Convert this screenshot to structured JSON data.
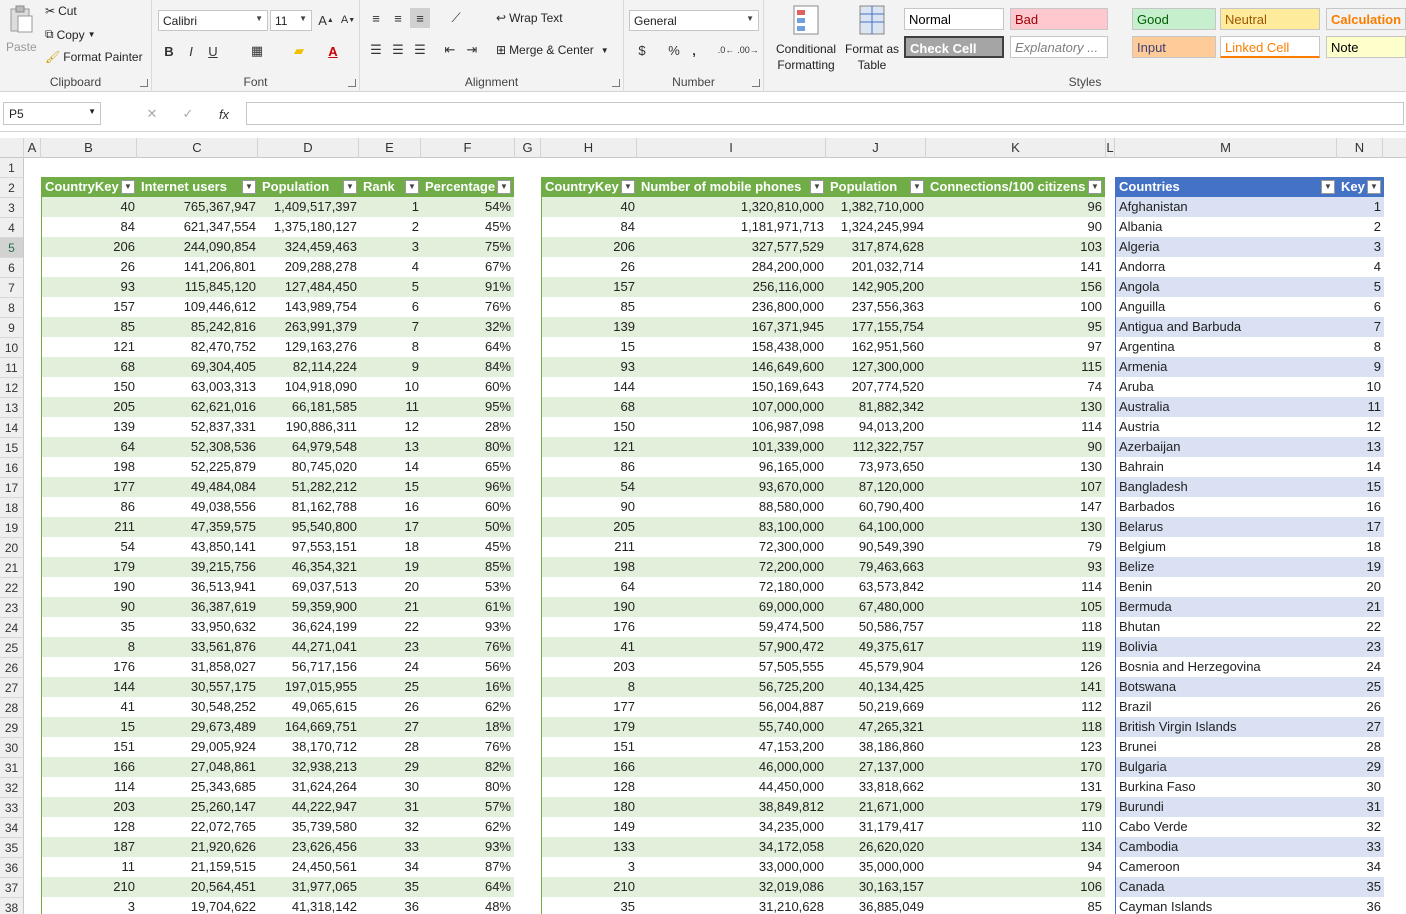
{
  "ribbon": {
    "clipboard": {
      "label": "Clipboard",
      "paste": "Paste",
      "cut": "Cut",
      "copy": "Copy",
      "format_painter": "Format Painter"
    },
    "font": {
      "label": "Font",
      "name": "Calibri",
      "size": "11",
      "bold": "B",
      "italic": "I",
      "underline": "U"
    },
    "alignment": {
      "label": "Alignment",
      "wrap_text": "Wrap Text",
      "merge_center": "Merge & Center"
    },
    "number": {
      "label": "Number",
      "format": "General",
      "currency": "$",
      "percent": "%",
      "comma": ","
    },
    "styles": {
      "label": "Styles",
      "conditional": "Conditional Formatting",
      "format_table": "Format as Table",
      "cells": [
        {
          "name": "Normal",
          "bg": "#ffffff",
          "fg": "#000000"
        },
        {
          "name": "Bad",
          "bg": "#ffc7ce",
          "fg": "#9c0006"
        },
        {
          "name": "Good",
          "bg": "#c6efce",
          "fg": "#006100"
        },
        {
          "name": "Neutral",
          "bg": "#ffeb9c",
          "fg": "#9c5700"
        },
        {
          "name": "Calculation",
          "bg": "#f2f2f2",
          "fg": "#fa7d00"
        },
        {
          "name": "Check Cell",
          "bg": "#a5a5a5",
          "fg": "#ffffff"
        },
        {
          "name": "Explanatory ...",
          "bg": "#ffffff",
          "fg": "#7f7f7f"
        },
        {
          "name": "Input",
          "bg": "#ffcc99",
          "fg": "#3f3f76"
        },
        {
          "name": "Linked Cell",
          "bg": "#ffffff",
          "fg": "#fa7d00"
        },
        {
          "name": "Note",
          "bg": "#ffffcc",
          "fg": "#000000"
        }
      ]
    }
  },
  "formula_bar": {
    "name_box": "P5",
    "fx": "fx"
  },
  "columns": [
    "A",
    "B",
    "C",
    "D",
    "E",
    "F",
    "G",
    "H",
    "I",
    "J",
    "K",
    "L",
    "M",
    "N"
  ],
  "colors": {
    "green_header": "#70ad47",
    "green_band": "#e2efda",
    "blue_header": "#4472c4",
    "blue_band": "#d9e1f2"
  },
  "table1": {
    "headers": [
      "CountryKey",
      "Internet users",
      "Population",
      "Rank",
      "Percentage"
    ],
    "rows": [
      [
        "40",
        "765,367,947",
        "1,409,517,397",
        "1",
        "54%"
      ],
      [
        "84",
        "621,347,554",
        "1,375,180,127",
        "2",
        "45%"
      ],
      [
        "206",
        "244,090,854",
        "324,459,463",
        "3",
        "75%"
      ],
      [
        "26",
        "141,206,801",
        "209,288,278",
        "4",
        "67%"
      ],
      [
        "93",
        "115,845,120",
        "127,484,450",
        "5",
        "91%"
      ],
      [
        "157",
        "109,446,612",
        "143,989,754",
        "6",
        "76%"
      ],
      [
        "85",
        "85,242,816",
        "263,991,379",
        "7",
        "32%"
      ],
      [
        "121",
        "82,470,752",
        "129,163,276",
        "8",
        "64%"
      ],
      [
        "68",
        "69,304,405",
        "82,114,224",
        "9",
        "84%"
      ],
      [
        "150",
        "63,003,313",
        "104,918,090",
        "10",
        "60%"
      ],
      [
        "205",
        "62,621,016",
        "66,181,585",
        "11",
        "95%"
      ],
      [
        "139",
        "52,837,331",
        "190,886,311",
        "12",
        "28%"
      ],
      [
        "64",
        "52,308,536",
        "64,979,548",
        "13",
        "80%"
      ],
      [
        "198",
        "52,225,879",
        "80,745,020",
        "14",
        "65%"
      ],
      [
        "177",
        "49,484,084",
        "51,282,212",
        "15",
        "96%"
      ],
      [
        "86",
        "49,038,556",
        "81,162,788",
        "16",
        "60%"
      ],
      [
        "211",
        "47,359,575",
        "95,540,800",
        "17",
        "50%"
      ],
      [
        "54",
        "43,850,141",
        "97,553,151",
        "18",
        "45%"
      ],
      [
        "179",
        "39,215,756",
        "46,354,321",
        "19",
        "85%"
      ],
      [
        "190",
        "36,513,941",
        "69,037,513",
        "20",
        "53%"
      ],
      [
        "90",
        "36,387,619",
        "59,359,900",
        "21",
        "61%"
      ],
      [
        "35",
        "33,950,632",
        "36,624,199",
        "22",
        "93%"
      ],
      [
        "8",
        "33,561,876",
        "44,271,041",
        "23",
        "76%"
      ],
      [
        "176",
        "31,858,027",
        "56,717,156",
        "24",
        "56%"
      ],
      [
        "144",
        "30,557,175",
        "197,015,955",
        "25",
        "16%"
      ],
      [
        "41",
        "30,548,252",
        "49,065,615",
        "26",
        "62%"
      ],
      [
        "15",
        "29,673,489",
        "164,669,751",
        "27",
        "18%"
      ],
      [
        "151",
        "29,005,924",
        "38,170,712",
        "28",
        "76%"
      ],
      [
        "166",
        "27,048,861",
        "32,938,213",
        "29",
        "82%"
      ],
      [
        "114",
        "25,343,685",
        "31,624,264",
        "30",
        "80%"
      ],
      [
        "203",
        "25,260,147",
        "44,222,947",
        "31",
        "57%"
      ],
      [
        "128",
        "22,072,765",
        "35,739,580",
        "32",
        "62%"
      ],
      [
        "187",
        "21,920,626",
        "23,626,456",
        "33",
        "93%"
      ],
      [
        "11",
        "21,159,515",
        "24,450,561",
        "34",
        "87%"
      ],
      [
        "210",
        "20,564,451",
        "31,977,065",
        "35",
        "64%"
      ],
      [
        "3",
        "19,704,622",
        "41,318,142",
        "36",
        "48%"
      ]
    ]
  },
  "table2": {
    "headers": [
      "CountryKey",
      "Number of mobile phones",
      "Population",
      "Connections/100 citizens"
    ],
    "rows": [
      [
        "40",
        "1,320,810,000",
        "1,382,710,000",
        "96"
      ],
      [
        "84",
        "1,181,971,713",
        "1,324,245,994",
        "90"
      ],
      [
        "206",
        "327,577,529",
        "317,874,628",
        "103"
      ],
      [
        "26",
        "284,200,000",
        "201,032,714",
        "141"
      ],
      [
        "157",
        "256,116,000",
        "142,905,200",
        "156"
      ],
      [
        "85",
        "236,800,000",
        "237,556,363",
        "100"
      ],
      [
        "139",
        "167,371,945",
        "177,155,754",
        "95"
      ],
      [
        "15",
        "158,438,000",
        "162,951,560",
        "97"
      ],
      [
        "93",
        "146,649,600",
        "127,300,000",
        "115"
      ],
      [
        "144",
        "150,169,643",
        "207,774,520",
        "74"
      ],
      [
        "68",
        "107,000,000",
        "81,882,342",
        "130"
      ],
      [
        "150",
        "106,987,098",
        "94,013,200",
        "114"
      ],
      [
        "121",
        "101,339,000",
        "112,322,757",
        "90"
      ],
      [
        "86",
        "96,165,000",
        "73,973,650",
        "130"
      ],
      [
        "54",
        "93,670,000",
        "87,120,000",
        "107"
      ],
      [
        "90",
        "88,580,000",
        "60,790,400",
        "147"
      ],
      [
        "205",
        "83,100,000",
        "64,100,000",
        "130"
      ],
      [
        "211",
        "72,300,000",
        "90,549,390",
        "79"
      ],
      [
        "198",
        "72,200,000",
        "79,463,663",
        "93"
      ],
      [
        "64",
        "72,180,000",
        "63,573,842",
        "114"
      ],
      [
        "190",
        "69,000,000",
        "67,480,000",
        "105"
      ],
      [
        "176",
        "59,474,500",
        "50,586,757",
        "118"
      ],
      [
        "41",
        "57,900,472",
        "49,375,617",
        "119"
      ],
      [
        "203",
        "57,505,555",
        "45,579,904",
        "126"
      ],
      [
        "8",
        "56,725,200",
        "40,134,425",
        "141"
      ],
      [
        "177",
        "56,004,887",
        "50,219,669",
        "112"
      ],
      [
        "179",
        "55,740,000",
        "47,265,321",
        "118"
      ],
      [
        "151",
        "47,153,200",
        "38,186,860",
        "123"
      ],
      [
        "166",
        "46,000,000",
        "27,137,000",
        "170"
      ],
      [
        "128",
        "44,450,000",
        "33,818,662",
        "131"
      ],
      [
        "180",
        "38,849,812",
        "21,671,000",
        "179"
      ],
      [
        "149",
        "34,235,000",
        "31,179,417",
        "110"
      ],
      [
        "133",
        "34,172,058",
        "26,620,020",
        "134"
      ],
      [
        "3",
        "33,000,000",
        "35,000,000",
        "94"
      ],
      [
        "210",
        "32,019,086",
        "30,163,157",
        "106"
      ],
      [
        "35",
        "31,210,628",
        "36,885,049",
        "85"
      ]
    ]
  },
  "table3": {
    "headers": [
      "Countries",
      "Key"
    ],
    "rows": [
      [
        "Afghanistan",
        "1"
      ],
      [
        "Albania",
        "2"
      ],
      [
        "Algeria",
        "3"
      ],
      [
        "Andorra",
        "4"
      ],
      [
        "Angola",
        "5"
      ],
      [
        "Anguilla",
        "6"
      ],
      [
        "Antigua and Barbuda",
        "7"
      ],
      [
        "Argentina",
        "8"
      ],
      [
        "Armenia",
        "9"
      ],
      [
        "Aruba",
        "10"
      ],
      [
        "Australia",
        "11"
      ],
      [
        "Austria",
        "12"
      ],
      [
        "Azerbaijan",
        "13"
      ],
      [
        "Bahrain",
        "14"
      ],
      [
        "Bangladesh",
        "15"
      ],
      [
        "Barbados",
        "16"
      ],
      [
        "Belarus",
        "17"
      ],
      [
        "Belgium",
        "18"
      ],
      [
        "Belize",
        "19"
      ],
      [
        "Benin",
        "20"
      ],
      [
        "Bermuda",
        "21"
      ],
      [
        "Bhutan",
        "22"
      ],
      [
        "Bolivia",
        "23"
      ],
      [
        "Bosnia and Herzegovina",
        "24"
      ],
      [
        "Botswana",
        "25"
      ],
      [
        "Brazil",
        "26"
      ],
      [
        "British Virgin Islands",
        "27"
      ],
      [
        "Brunei",
        "28"
      ],
      [
        "Bulgaria",
        "29"
      ],
      [
        "Burkina Faso",
        "30"
      ],
      [
        "Burundi",
        "31"
      ],
      [
        "Cabo Verde",
        "32"
      ],
      [
        "Cambodia",
        "33"
      ],
      [
        "Cameroon",
        "34"
      ],
      [
        "Canada",
        "35"
      ],
      [
        "Cayman Islands",
        "36"
      ]
    ]
  }
}
